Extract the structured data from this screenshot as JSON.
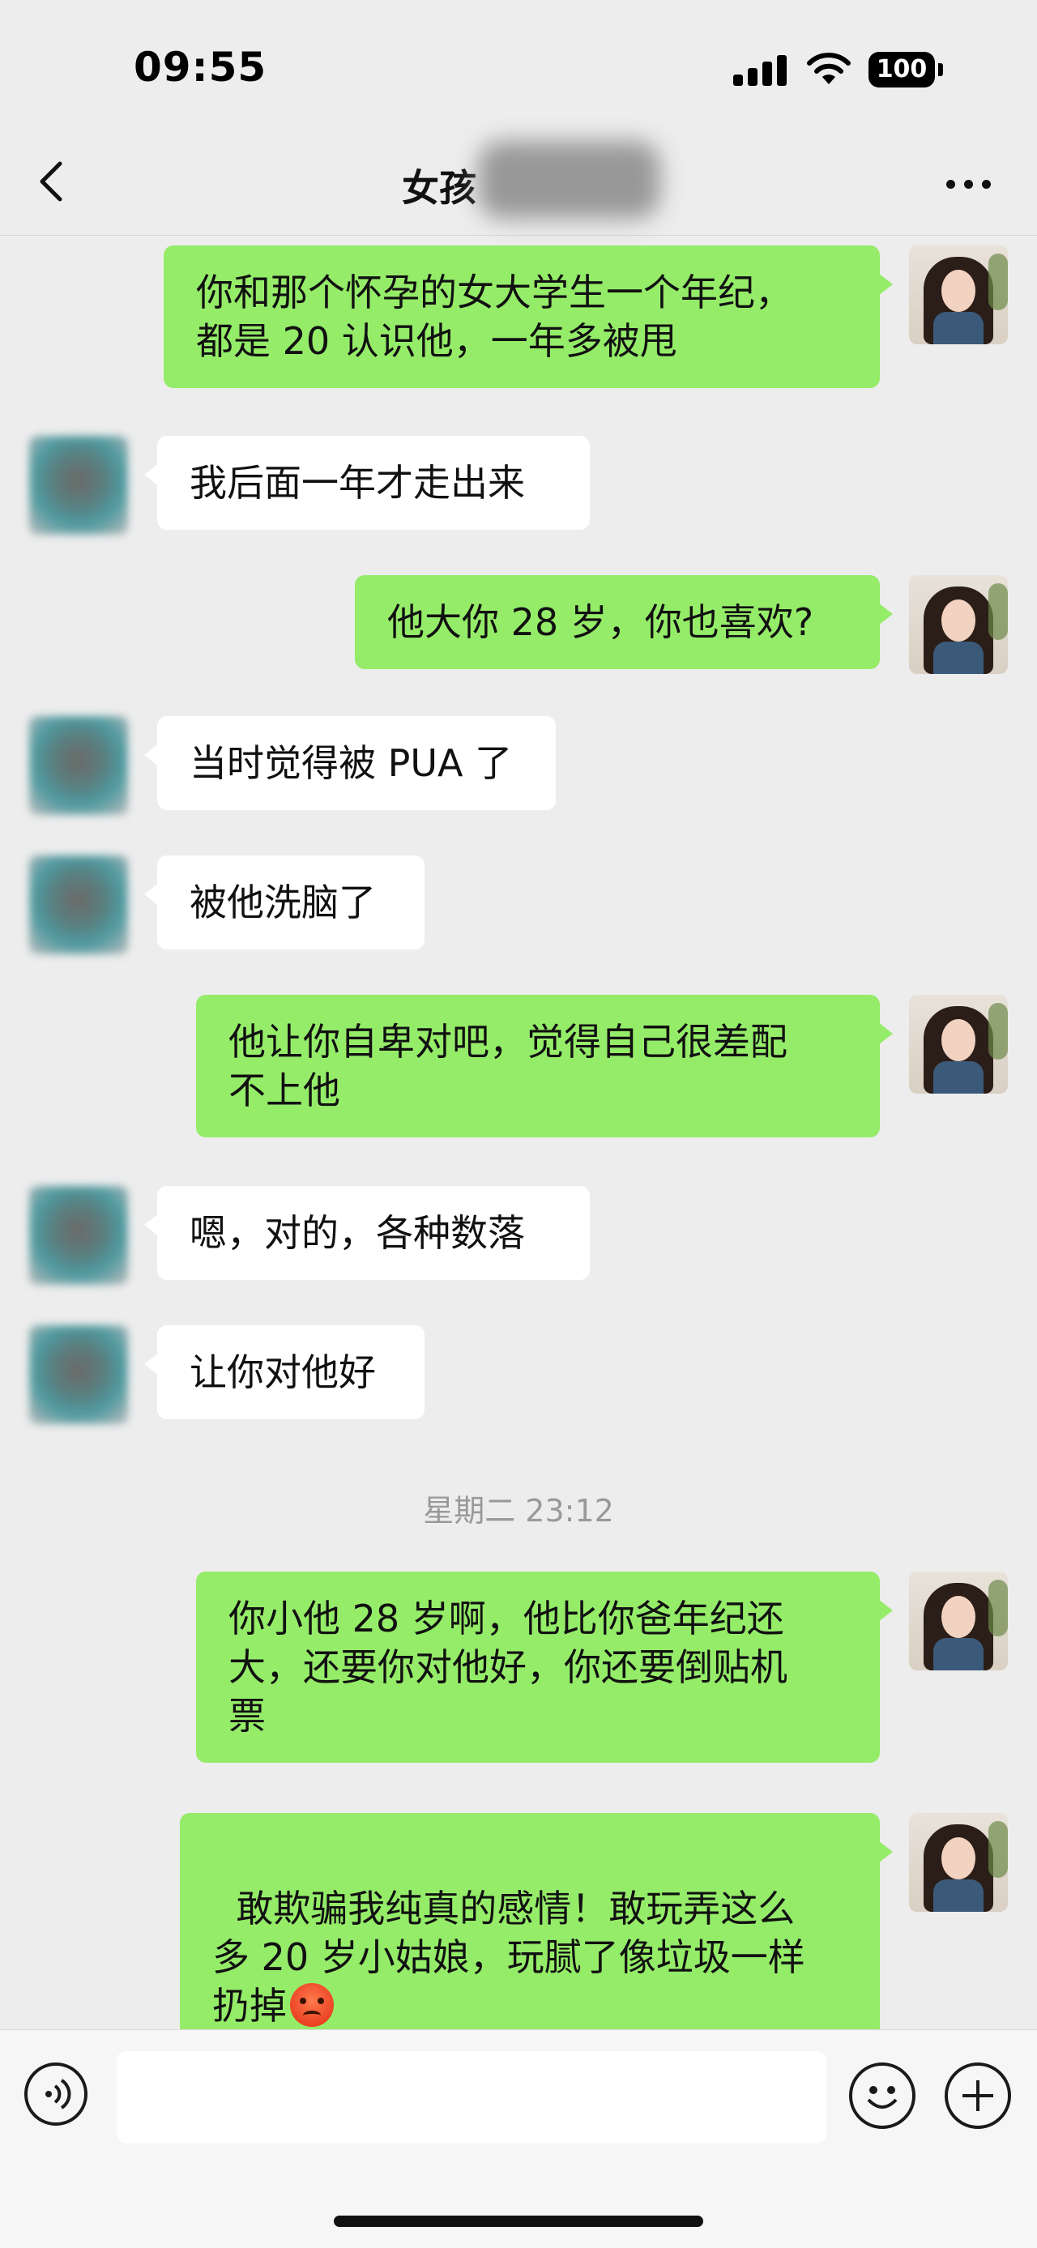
{
  "status_bar": {
    "time": "09:55",
    "battery": "100"
  },
  "nav": {
    "title": "女孩"
  },
  "messages": [
    {
      "from": "me",
      "text": "你和那个怀孕的女大学生一个年纪，\n都是 20 认识他，一年多被甩"
    },
    {
      "from": "them",
      "text": "我后面一年才走出来"
    },
    {
      "from": "me",
      "text": "他大你 28 岁，你也喜欢?"
    },
    {
      "from": "them",
      "text": "当时觉得被 PUA 了"
    },
    {
      "from": "them",
      "text": "被他洗脑了"
    },
    {
      "from": "me",
      "text": "他让你自卑对吧，觉得自己很差配\n不上他"
    },
    {
      "from": "them",
      "text": "嗯，对的，各种数落"
    },
    {
      "from": "them",
      "text": "让你对他好"
    },
    {
      "from": "me",
      "text": "你小他 28 岁啊，他比你爸年纪还\n大，还要你对他好，你还要倒贴机\n票"
    },
    {
      "from": "me",
      "text": "敢欺骗我纯真的感情！敢玩弄这么\n多 20 岁小姑娘，玩腻了像垃圾一样\n扔掉",
      "emoji": "angry-face-emoji"
    }
  ],
  "timestamp": "星期二 23:12",
  "input_bar": {
    "placeholder": ""
  },
  "colors": {
    "my_bubble": "#95ec69",
    "their_bubble": "#ffffff",
    "background": "#ededed"
  }
}
